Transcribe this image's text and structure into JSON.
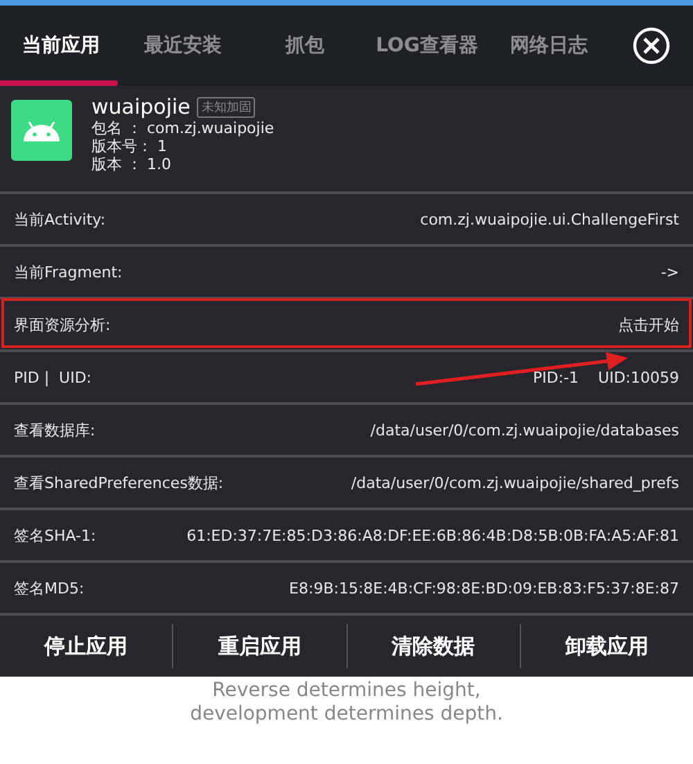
{
  "tabs": [
    {
      "label": "当前应用",
      "selected": true
    },
    {
      "label": "最近安装",
      "selected": false
    },
    {
      "label": "抓包",
      "selected": false
    },
    {
      "label": "LOG查看器",
      "selected": false
    },
    {
      "label": "网络日志",
      "selected": false
    }
  ],
  "app": {
    "name": "wuaipojie",
    "badge": "未知加固",
    "details": [
      {
        "label": "包名 ：",
        "value": "com.zj.wuaipojie"
      },
      {
        "label": "版本号：",
        "value": "1"
      },
      {
        "label": "版本 ：",
        "value": "1.0"
      }
    ]
  },
  "rows": [
    {
      "label": "当前Activity:",
      "value": "com.zj.wuaipojie.ui.ChallengeFirst",
      "highlighted": false
    },
    {
      "label": "当前Fragment:",
      "value": "->",
      "highlighted": false
    },
    {
      "label": "界面资源分析:",
      "value": "点击开始",
      "highlighted": true
    },
    {
      "label": "PID |  UID:",
      "value": "PID:-1    UID:10059",
      "highlighted": false
    },
    {
      "label": "查看数据库:",
      "value": "/data/user/0/com.zj.wuaipojie/databases",
      "highlighted": false
    },
    {
      "label": "查看SharedPreferences数据:",
      "value": "/data/user/0/com.zj.wuaipojie/shared_prefs",
      "highlighted": false
    },
    {
      "label": "签名SHA-1:",
      "value": "61:ED:37:7E:85:D3:86:A8:DF:EE:6B:86:4B:D8:5B:0B:FA:A5:AF:81",
      "highlighted": false
    },
    {
      "label": "签名MD5:",
      "value": "E8:9B:15:8E:4B:CF:98:8E:BD:09:EB:83:F5:37:8E:87",
      "highlighted": false
    }
  ],
  "actions": [
    "停止应用",
    "重启应用",
    "清除数据",
    "卸载应用"
  ],
  "caption": [
    "Reverse determines height,",
    "development determines depth."
  ]
}
